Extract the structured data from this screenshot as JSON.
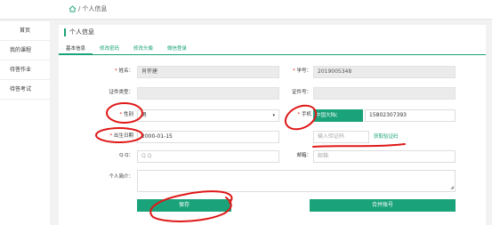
{
  "breadcrumb": {
    "separator": "/",
    "current": "个人信息"
  },
  "sidebar": {
    "items": [
      {
        "label": "首页"
      },
      {
        "label": "我的课程"
      },
      {
        "label": "待答作业"
      },
      {
        "label": "待答考试"
      }
    ]
  },
  "panel": {
    "title": "个人信息"
  },
  "tabs": [
    {
      "label": "基本信息"
    },
    {
      "label": "修改密码"
    },
    {
      "label": "修改头像"
    },
    {
      "label": "微信登录"
    }
  ],
  "form": {
    "name": {
      "label": "姓名：",
      "value": "肖怀建"
    },
    "student_id": {
      "label": "学号：",
      "value": "2019005348"
    },
    "id_type": {
      "label": "证件类型：",
      "value": ""
    },
    "id_number": {
      "label": "证件号：",
      "value": ""
    },
    "gender": {
      "label": "性别",
      "value": "男"
    },
    "phone": {
      "label": "手机",
      "country": "中国大陆(",
      "value": "15802307393"
    },
    "birthday": {
      "label": "出生日期",
      "value": "2000-01-15"
    },
    "verify_code": {
      "placeholder": "输入验证码",
      "link": "获取验证码"
    },
    "qq": {
      "label": "Q Q：",
      "placeholder": "Q Q"
    },
    "email": {
      "label": "邮箱：",
      "placeholder": "邮箱"
    },
    "bio": {
      "label": "个人简介："
    }
  },
  "actions": {
    "save": "保存",
    "merge": "合并账号"
  },
  "colors": {
    "accent": "#1aa37a",
    "required": "#e02020",
    "annotation": "#e01818"
  },
  "icons": {
    "home": "home-icon",
    "dropdown": "chevron-down-icon"
  }
}
